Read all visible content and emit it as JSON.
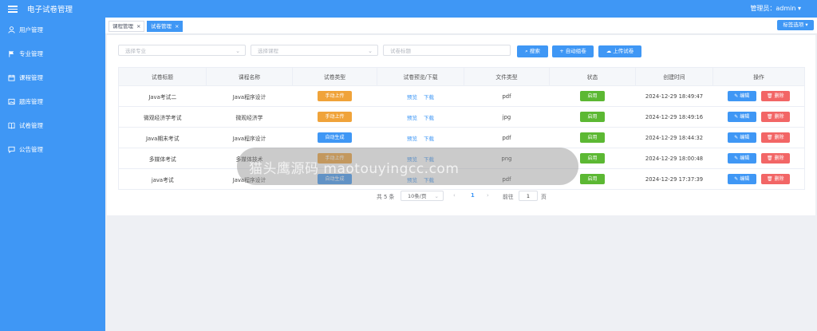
{
  "header": {
    "app_title": "电子试卷管理",
    "admin_label": "管理员：admin ▾"
  },
  "sidebar": {
    "items": [
      {
        "label": "用户管理",
        "icon": "user-icon"
      },
      {
        "label": "专业管理",
        "icon": "flag-icon"
      },
      {
        "label": "课程管理",
        "icon": "calendar-icon"
      },
      {
        "label": "题库管理",
        "icon": "image-icon"
      },
      {
        "label": "试卷管理",
        "icon": "book-icon"
      },
      {
        "label": "公告管理",
        "icon": "chat-icon"
      }
    ]
  },
  "tabs": [
    {
      "label": "课程管理",
      "close": "×",
      "active": false
    },
    {
      "label": "试卷管理",
      "close": "×",
      "active": true
    }
  ],
  "tab_options_label": "标签选项 ▾",
  "filters": {
    "major_placeholder": "选择专业",
    "course_placeholder": "选择课程",
    "title_placeholder": "试卷标题",
    "search_label": "搜索",
    "auto_label": "自动组卷",
    "upload_label": "上传试卷"
  },
  "table": {
    "headers": [
      "试卷标题",
      "课程名称",
      "试卷类型",
      "试卷预览/下载",
      "文件类型",
      "状态",
      "创建时间",
      "操作"
    ],
    "preview_label": "预览",
    "download_label": "下载",
    "edit_label": "编辑",
    "delete_label": "删除",
    "rows": [
      {
        "title": "Java考试二",
        "course": "Java程序设计",
        "type": "手动上传",
        "type_color": "orange",
        "file": "pdf",
        "status": "启用",
        "created": "2024-12-29 18:49:47"
      },
      {
        "title": "微观经济学考试",
        "course": "微观经济学",
        "type": "手动上传",
        "type_color": "orange",
        "file": "jpg",
        "status": "启用",
        "created": "2024-12-29 18:49:16"
      },
      {
        "title": "Java期末考试",
        "course": "Java程序设计",
        "type": "自动生成",
        "type_color": "blue",
        "file": "pdf",
        "status": "启用",
        "created": "2024-12-29 18:44:32"
      },
      {
        "title": "多媒体考试",
        "course": "多媒体技术",
        "type": "手动上传",
        "type_color": "orange",
        "file": "png",
        "status": "启用",
        "created": "2024-12-29 18:00:48"
      },
      {
        "title": "java考试",
        "course": "Java程序设计",
        "type": "自动生成",
        "type_color": "blue",
        "file": "pdf",
        "status": "启用",
        "created": "2024-12-29 17:37:39"
      }
    ]
  },
  "pagination": {
    "total": "共 5 条",
    "page_size": "10条/页",
    "prev": "‹",
    "current": "1",
    "next": "›",
    "goto_prefix": "前往",
    "goto_value": "1",
    "goto_suffix": "页"
  },
  "overlay_text": "猫头鹰源码 maotouyingcc.com",
  "colors": {
    "primary": "#3f97f5",
    "orange": "#f0a33a",
    "green": "#5cb833",
    "danger": "#f26666"
  }
}
